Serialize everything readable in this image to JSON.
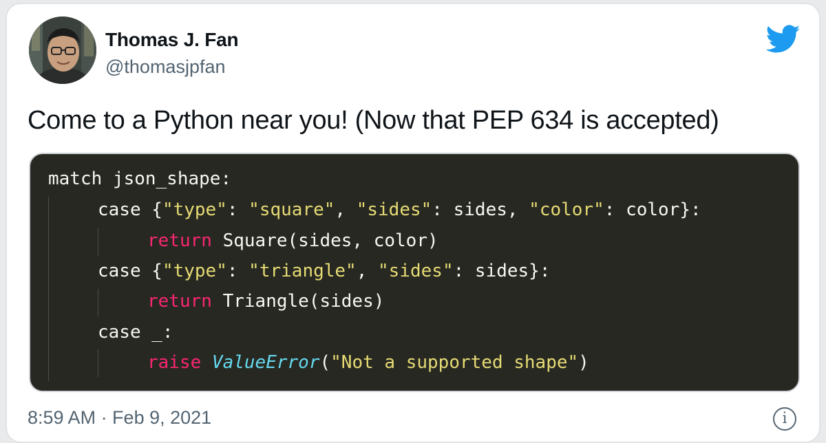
{
  "author": {
    "name": "Thomas J. Fan",
    "handle": "@thomasjpfan"
  },
  "tweet": {
    "text": "Come to a Python near you! (Now that PEP 634 is accepted)",
    "timestamp": "8:59 AM · Feb 9, 2021"
  },
  "code": {
    "line1_text": "match json_shape:",
    "line2_case": "case ",
    "line2_open": "{",
    "line2_type": "\"type\"",
    "line2_colon1": ": ",
    "line2_square": "\"square\"",
    "line2_comma1": ", ",
    "line2_sides_key": "\"sides\"",
    "line2_mid": ": sides, ",
    "line2_color_key": "\"color\"",
    "line2_end": ": color}:",
    "line3_return": "return",
    "line3_rest": " Square(sides, color)",
    "line4_case": "case ",
    "line4_open": "{",
    "line4_type": "\"type\"",
    "line4_colon1": ": ",
    "line4_triangle": "\"triangle\"",
    "line4_comma1": ", ",
    "line4_sides_key": "\"sides\"",
    "line4_end": ": sides}:",
    "line5_return": "return",
    "line5_rest": " Triangle(sides)",
    "line6_text": "case _:",
    "line7_raise": "raise",
    "line7_space": " ",
    "line7_class": "ValueError",
    "line7_open": "(",
    "line7_str": "\"Not a supported shape\"",
    "line7_close": ")"
  },
  "icons": {
    "brand": "twitter-bird-icon",
    "info": "info-icon"
  },
  "colors": {
    "twitter_blue": "#1d9bf0",
    "code_background": "#272822",
    "keyword_pink": "#f92672",
    "string_yellow": "#e6db74",
    "class_cyan": "#66d9ef"
  }
}
